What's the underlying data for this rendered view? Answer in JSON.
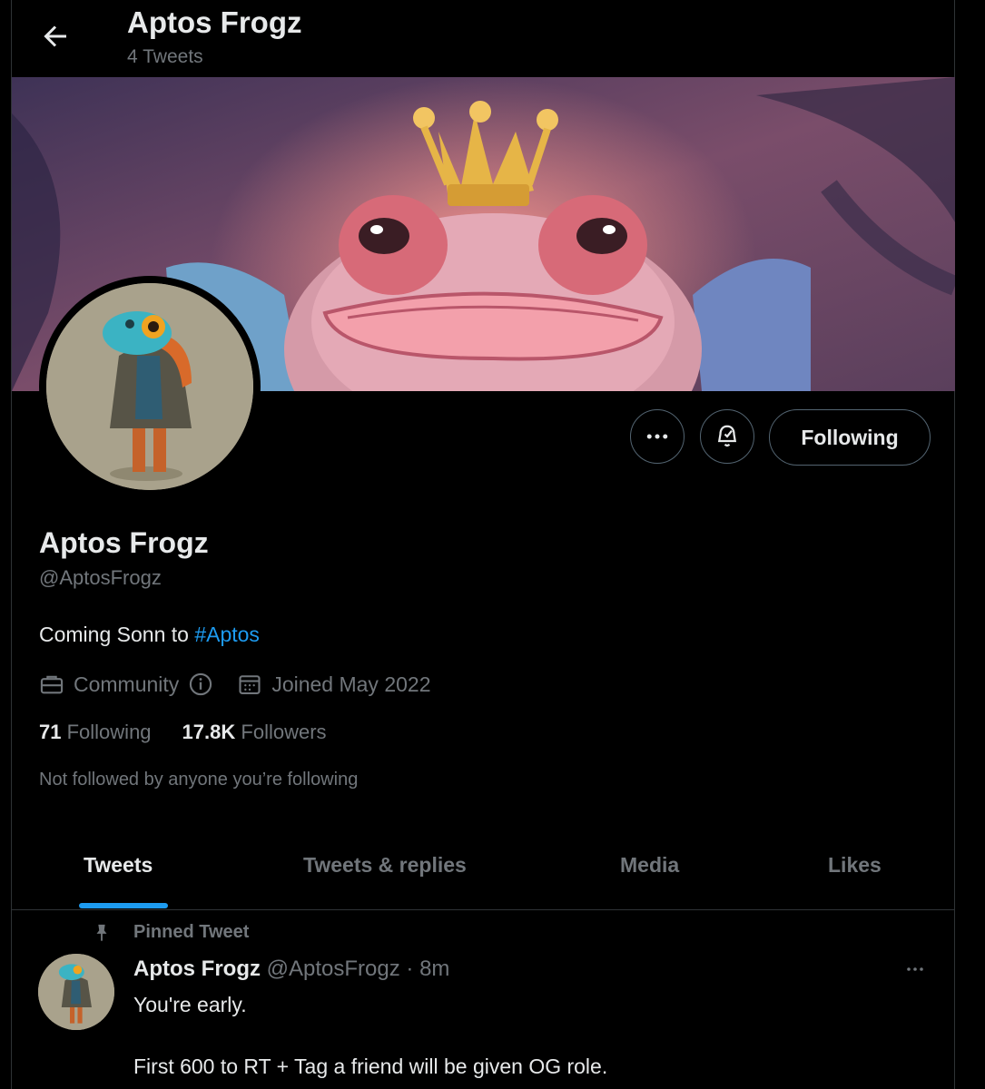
{
  "header": {
    "title": "Aptos Frogz",
    "tweet_count": "4 Tweets"
  },
  "profile": {
    "name": "Aptos Frogz",
    "handle": "@AptosFrogz",
    "bio_text": "Coming Sonn to ",
    "bio_hashtag": "#Aptos",
    "category": "Community",
    "joined": "Joined May 2022",
    "following_count": "71",
    "following_label": "Following",
    "followers_count": "17.8K",
    "followers_label": "Followers",
    "not_followed": "Not followed by anyone you’re following"
  },
  "actions": {
    "follow_label": "Following"
  },
  "tabs": [
    {
      "label": "Tweets",
      "active": true
    },
    {
      "label": "Tweets & replies",
      "active": false
    },
    {
      "label": "Media",
      "active": false
    },
    {
      "label": "Likes",
      "active": false
    }
  ],
  "pinned_tweet": {
    "pinned_label": "Pinned Tweet",
    "author_name": "Aptos Frogz",
    "author_handle": "@AptosFrogz",
    "time": "· 8m",
    "line1": "You're early.",
    "line2": "First 600 to RT + Tag a friend will be given OG role."
  },
  "colors": {
    "accent": "#1d9bf0",
    "background": "#000000",
    "muted_text": "#71767b"
  },
  "icons": [
    "back-arrow-icon",
    "more-icon",
    "notification-bell-icon",
    "briefcase-icon",
    "info-icon",
    "calendar-icon",
    "pin-icon"
  ]
}
